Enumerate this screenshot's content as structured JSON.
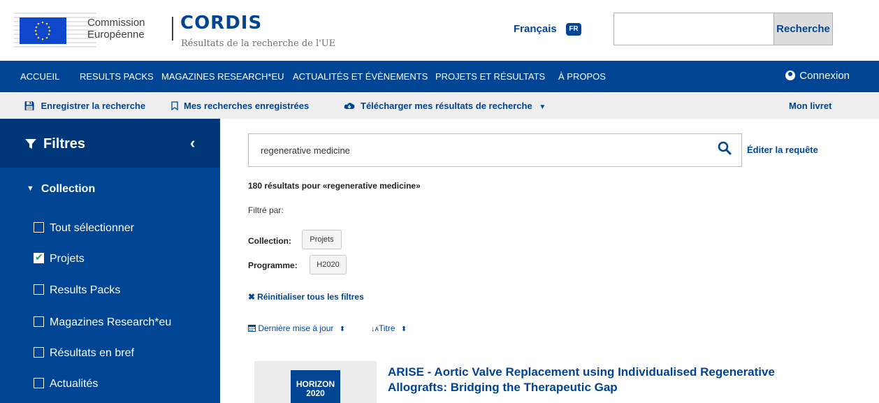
{
  "header": {
    "commission_line1": "Commission",
    "commission_line2": "Européenne",
    "cordis_title": "CORDIS",
    "cordis_subtitle": "Résultats de la recherche de l'UE",
    "language_label": "Français",
    "language_code": "FR",
    "search_placeholder": "",
    "search_button": "Recherche"
  },
  "nav": {
    "items": [
      "ACCUEIL",
      "RESULTS PACKS",
      "MAGAZINES RESEARCH*EU",
      "ACTUALITÉS ET ÉVÈNEMENTS",
      "PROJETS ET RÉSULTATS",
      "À PROPOS"
    ],
    "login": "Connexion"
  },
  "toolbar": {
    "save_search": "Enregistrer la recherche",
    "my_searches": "Mes recherches enregistrées",
    "download": "Télécharger mes résultats de recherche",
    "my_booklet": "Mon livret"
  },
  "sidebar": {
    "title": "Filtres",
    "collection_title": "Collection",
    "items": [
      {
        "label": "Tout sélectionner",
        "checked": false
      },
      {
        "label": "Projets",
        "checked": true
      },
      {
        "label": "Results Packs",
        "checked": false
      },
      {
        "label": "Magazines Research*eu",
        "checked": false
      },
      {
        "label": "Résultats en bref",
        "checked": false
      },
      {
        "label": "Actualités",
        "checked": false
      }
    ]
  },
  "main": {
    "query": "regenerative medicine",
    "edit_query": "Éditer la requête",
    "results_count": "180 résultats pour «regenerative medicine»",
    "filtered_by": "Filtré par:",
    "filters": {
      "collection_label": "Collection:",
      "collection_value": "Projets",
      "programme_label": "Programme:",
      "programme_value": "H2020"
    },
    "reset_filters": "Réinitialiser tous les filtres",
    "sort_date": "Dernière mise à jour",
    "sort_title": "Titre"
  },
  "result": {
    "logo_text_line1": "HORIZON",
    "logo_text_line2": "2020",
    "title": "ARISE - Aortic Valve Replacement using Individualised Regenerative Allografts: Bridging the Therapeutic Gap"
  },
  "colors": {
    "brand_blue": "#004494",
    "filter_header": "#003779",
    "toolbar_bg": "#eeeeee",
    "check_green": "#2e9b4a"
  }
}
